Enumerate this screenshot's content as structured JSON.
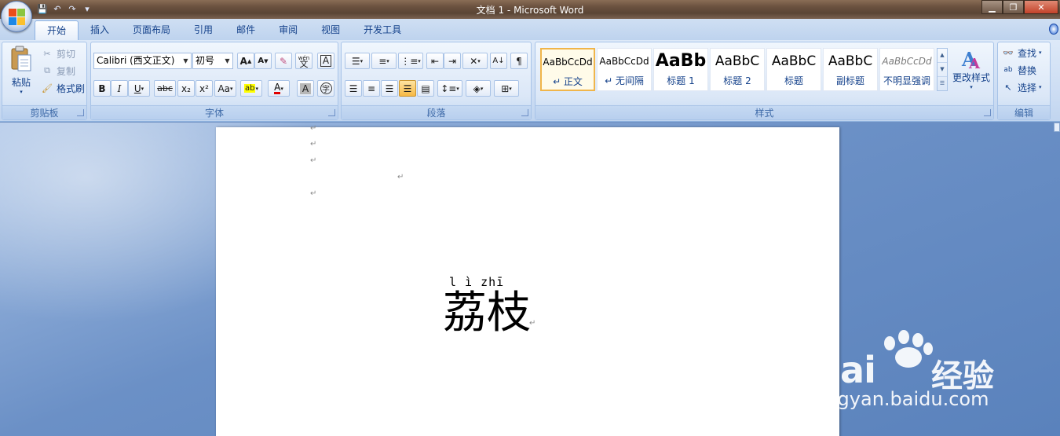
{
  "window": {
    "title": "文档 1 - Microsoft Word"
  },
  "qat": {
    "save": "💾",
    "undo": "↶",
    "redo": "↷",
    "more": "▾"
  },
  "tabs": [
    "开始",
    "插入",
    "页面布局",
    "引用",
    "邮件",
    "审阅",
    "视图",
    "开发工具"
  ],
  "clipboard": {
    "label": "剪贴板",
    "paste": "粘贴",
    "cut": "剪切",
    "copy": "复制",
    "format_painter": "格式刷"
  },
  "font": {
    "label": "字体",
    "font_name": "Calibri (西文正文)",
    "font_size": "初号",
    "grow": "A",
    "shrink": "A",
    "clear": "✎",
    "phonetic": "文",
    "phonetic_top": "wén",
    "border_char": "A",
    "bold": "B",
    "italic": "I",
    "underline": "U",
    "strike": "abc",
    "subscript": "x₂",
    "superscript": "x²",
    "change_case": "Aa",
    "highlight": "ab",
    "font_color": "A",
    "shade_char": "A",
    "enclose": "字"
  },
  "paragraph": {
    "label": "段落"
  },
  "styles": {
    "label": "样式",
    "items": [
      {
        "sample": "AaBbCcDd",
        "name": "↵ 正文"
      },
      {
        "sample": "AaBbCcDd",
        "name": "↵ 无间隔"
      },
      {
        "sample": "AaBb",
        "name": "标题 1"
      },
      {
        "sample": "AaBbC",
        "name": "标题 2"
      },
      {
        "sample": "AaBbC",
        "name": "标题"
      },
      {
        "sample": "AaBbC",
        "name": "副标题"
      },
      {
        "sample": "AaBbCcDd",
        "name": "不明显强调"
      }
    ],
    "change_styles": "更改样式"
  },
  "editing": {
    "label": "编辑",
    "find": "查找",
    "replace": "替换",
    "select": "选择"
  },
  "document": {
    "pinyin": "l ì zhī",
    "text": "荔枝",
    "para_mark": "↵"
  },
  "watermark": {
    "brand": "Bai",
    "suffix": "经验",
    "url": "jingyan.baidu.com"
  }
}
